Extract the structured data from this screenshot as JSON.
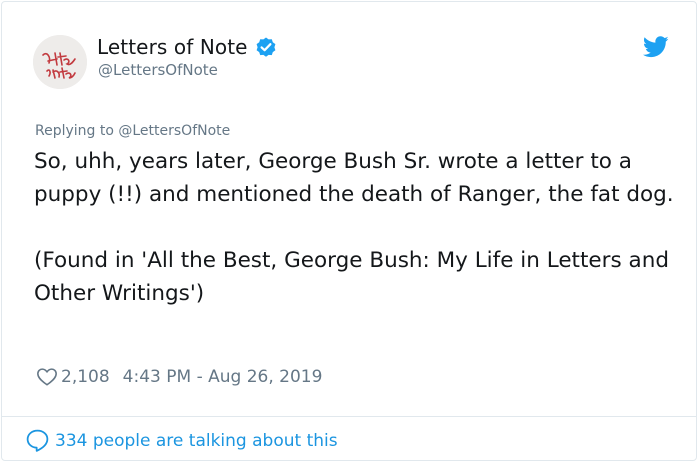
{
  "author": {
    "display_name": "Letters of Note",
    "handle": "@LettersOfNote",
    "verified": true,
    "avatar_text": "Letters of Note"
  },
  "tweet": {
    "replying_to": "Replying to @LettersOfNote",
    "paragraphs": [
      "So, uhh, years later, George Bush Sr. wrote a letter to a puppy (!!) and mentioned the death of Ranger, the fat dog.",
      "(Found in 'All the Best, George Bush: My Life in Letters and Other Writings')"
    ],
    "likes": "2,108",
    "timestamp": "4:43 PM - Aug 26, 2019"
  },
  "footer": {
    "talking_text": "334 people are talking about this"
  },
  "colors": {
    "text": "#14171a",
    "secondary": "#657786",
    "link": "#1b95e0",
    "verified": "#1da1f2",
    "divider": "#e1e8ed"
  },
  "icons": {
    "verified": "verified-badge-icon",
    "brand": "twitter-bird-icon",
    "like": "heart-icon",
    "conversation": "speech-bubble-icon"
  }
}
